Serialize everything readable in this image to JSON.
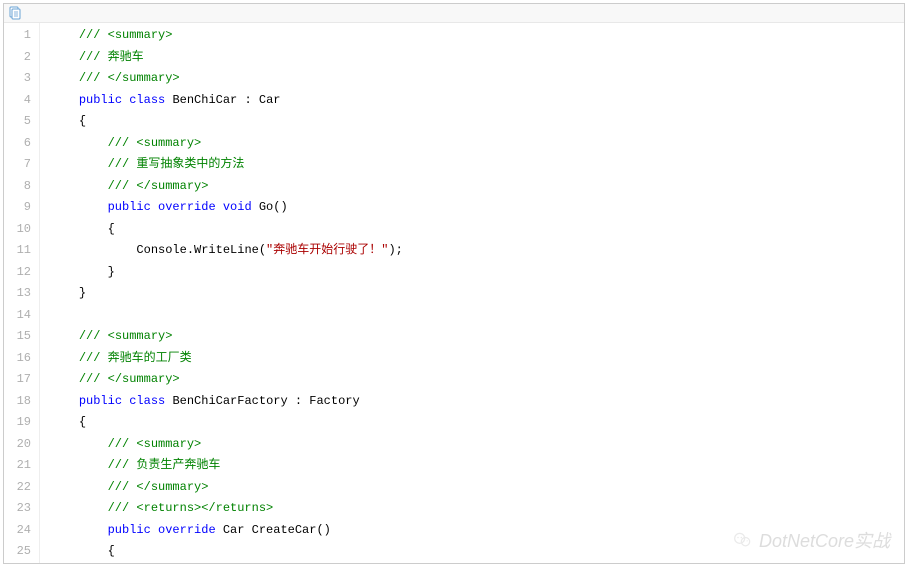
{
  "toolbar": {
    "copy_label": "copy"
  },
  "watermark": {
    "text": "DotNetCore实战"
  },
  "code": {
    "lines": [
      {
        "n": 1,
        "ind": 1,
        "t": [
          {
            "c": "cmt",
            "s": "/// <summary>"
          }
        ]
      },
      {
        "n": 2,
        "ind": 1,
        "t": [
          {
            "c": "cmt",
            "s": "/// 奔驰车"
          }
        ]
      },
      {
        "n": 3,
        "ind": 1,
        "t": [
          {
            "c": "cmt",
            "s": "/// </summary>"
          }
        ]
      },
      {
        "n": 4,
        "ind": 1,
        "t": [
          {
            "c": "kw",
            "s": "public"
          },
          {
            "c": "plain",
            "s": " "
          },
          {
            "c": "kw",
            "s": "class"
          },
          {
            "c": "plain",
            "s": " BenChiCar : Car"
          }
        ]
      },
      {
        "n": 5,
        "ind": 1,
        "t": [
          {
            "c": "punc",
            "s": "{"
          }
        ]
      },
      {
        "n": 6,
        "ind": 2,
        "t": [
          {
            "c": "cmt",
            "s": "/// <summary>"
          }
        ]
      },
      {
        "n": 7,
        "ind": 2,
        "t": [
          {
            "c": "cmt",
            "s": "/// 重写抽象类中的方法"
          }
        ]
      },
      {
        "n": 8,
        "ind": 2,
        "t": [
          {
            "c": "cmt",
            "s": "/// </summary>"
          }
        ]
      },
      {
        "n": 9,
        "ind": 2,
        "t": [
          {
            "c": "kw",
            "s": "public"
          },
          {
            "c": "plain",
            "s": " "
          },
          {
            "c": "kw",
            "s": "override"
          },
          {
            "c": "plain",
            "s": " "
          },
          {
            "c": "kw",
            "s": "void"
          },
          {
            "c": "plain",
            "s": " Go()"
          }
        ]
      },
      {
        "n": 10,
        "ind": 2,
        "t": [
          {
            "c": "punc",
            "s": "{"
          }
        ]
      },
      {
        "n": 11,
        "ind": 3,
        "t": [
          {
            "c": "plain",
            "s": "Console.WriteLine("
          },
          {
            "c": "str-red",
            "s": "\"奔驰车开始行驶了！\""
          },
          {
            "c": "plain",
            "s": ");"
          }
        ]
      },
      {
        "n": 12,
        "ind": 2,
        "t": [
          {
            "c": "punc",
            "s": "}"
          }
        ]
      },
      {
        "n": 13,
        "ind": 1,
        "t": [
          {
            "c": "punc",
            "s": "}"
          }
        ]
      },
      {
        "n": 14,
        "ind": 0,
        "t": []
      },
      {
        "n": 15,
        "ind": 1,
        "t": [
          {
            "c": "cmt",
            "s": "/// <summary>"
          }
        ]
      },
      {
        "n": 16,
        "ind": 1,
        "t": [
          {
            "c": "cmt",
            "s": "/// 奔驰车的工厂类"
          }
        ]
      },
      {
        "n": 17,
        "ind": 1,
        "t": [
          {
            "c": "cmt",
            "s": "/// </summary>"
          }
        ]
      },
      {
        "n": 18,
        "ind": 1,
        "t": [
          {
            "c": "kw",
            "s": "public"
          },
          {
            "c": "plain",
            "s": " "
          },
          {
            "c": "kw",
            "s": "class"
          },
          {
            "c": "plain",
            "s": " BenChiCarFactory : Factory"
          }
        ]
      },
      {
        "n": 19,
        "ind": 1,
        "t": [
          {
            "c": "punc",
            "s": "{"
          }
        ]
      },
      {
        "n": 20,
        "ind": 2,
        "t": [
          {
            "c": "cmt",
            "s": "/// <summary>"
          }
        ]
      },
      {
        "n": 21,
        "ind": 2,
        "t": [
          {
            "c": "cmt",
            "s": "/// 负责生产奔驰车"
          }
        ]
      },
      {
        "n": 22,
        "ind": 2,
        "t": [
          {
            "c": "cmt",
            "s": "/// </summary>"
          }
        ]
      },
      {
        "n": 23,
        "ind": 2,
        "t": [
          {
            "c": "cmt",
            "s": "/// <returns></returns>"
          }
        ]
      },
      {
        "n": 24,
        "ind": 2,
        "t": [
          {
            "c": "kw",
            "s": "public"
          },
          {
            "c": "plain",
            "s": " "
          },
          {
            "c": "kw",
            "s": "override"
          },
          {
            "c": "plain",
            "s": " Car CreateCar()"
          }
        ]
      },
      {
        "n": 25,
        "ind": 2,
        "t": [
          {
            "c": "punc",
            "s": "{"
          }
        ]
      }
    ]
  }
}
